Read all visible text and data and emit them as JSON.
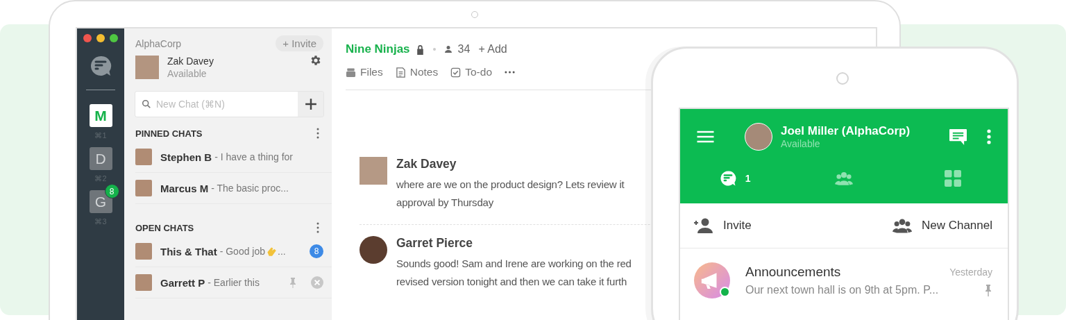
{
  "laptop": {
    "rail": {
      "workspaces": [
        {
          "letter": "M",
          "shortcut": "⌘1",
          "selected": true
        },
        {
          "letter": "D",
          "shortcut": "⌘2",
          "selected": false
        },
        {
          "letter": "G",
          "shortcut": "⌘3",
          "selected": false,
          "badge": "8"
        }
      ]
    },
    "sidebar": {
      "team": "AlphaCorp",
      "invite": "+ Invite",
      "user": {
        "name": "Zak Davey",
        "status": "Available"
      },
      "search": {
        "placeholder": "New Chat (⌘N)"
      },
      "sections": [
        {
          "title": "PINNED CHATS",
          "chats": [
            {
              "name": "Stephen B",
              "preview": "- I have a thing for"
            },
            {
              "name": "Marcus M",
              "preview": "- The basic proc..."
            }
          ]
        },
        {
          "title": "OPEN CHATS",
          "chats": [
            {
              "name": "This & That",
              "preview": "- Good job",
              "clap": true,
              "preview_end": "...",
              "unread": "8"
            },
            {
              "name": "Garrett P",
              "preview": "- Earlier this",
              "pinned": true,
              "closable": true
            }
          ]
        }
      ]
    },
    "main": {
      "channel": "Nine Ninjas",
      "locked": true,
      "members": "34",
      "add": "+ Add",
      "tabs": [
        {
          "kind": "files",
          "label": "Files"
        },
        {
          "kind": "notes",
          "label": "Notes"
        },
        {
          "kind": "todo",
          "label": "To-do"
        }
      ],
      "messages": [
        {
          "author": "Zak Davey",
          "lines": [
            "where are we on the product design? Lets review it",
            "approval by Thursday"
          ]
        },
        {
          "author": "Garret Pierce",
          "lines": [
            "Sounds good! Sam and Irene are working on the red",
            "revised version tonight and then we can take it furth"
          ]
        }
      ]
    }
  },
  "phone": {
    "user": {
      "name": "Joel Miller (AlphaCorp)",
      "status": "Available"
    },
    "tabs": [
      {
        "kind": "chats",
        "count": "1",
        "selected": true
      },
      {
        "kind": "people",
        "selected": false
      },
      {
        "kind": "apps",
        "selected": false
      }
    ],
    "actions": [
      {
        "kind": "invite",
        "label": "Invite"
      },
      {
        "kind": "channel",
        "label": "New Channel"
      }
    ],
    "chats": [
      {
        "name": "Announcements",
        "time": "Yesterday",
        "preview": "Our next town hall is on 9th at 5pm. P...",
        "pinned": true,
        "online": true
      }
    ]
  }
}
